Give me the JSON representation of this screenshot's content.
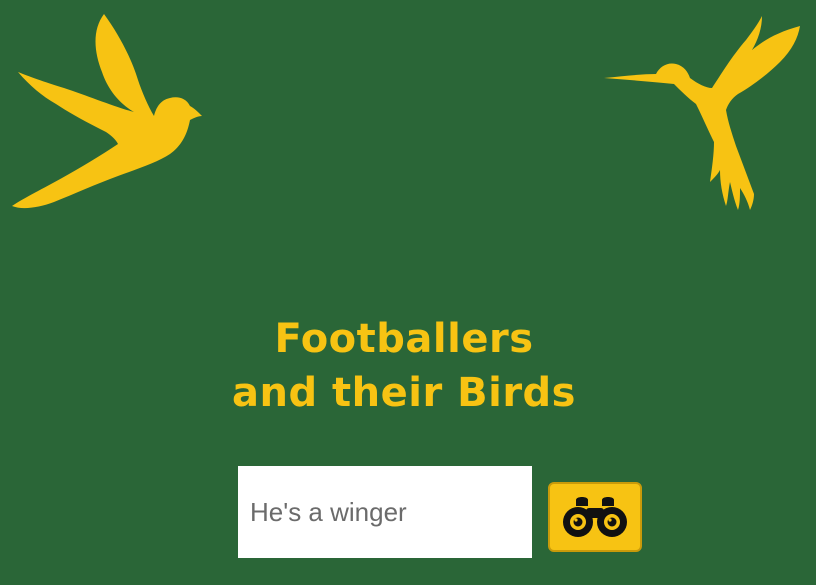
{
  "title": {
    "line1": "Footballers",
    "line2": "and their Birds"
  },
  "search": {
    "placeholder": "He's a winger",
    "value": ""
  },
  "search_button": {
    "icon": "binoculars-icon"
  },
  "decorations": {
    "left_bird": "dove-icon",
    "right_bird": "hummingbird-icon"
  },
  "colors": {
    "background": "#2a6637",
    "accent": "#f7c313",
    "button_border": "#c99a0a",
    "icon": "#111111"
  }
}
